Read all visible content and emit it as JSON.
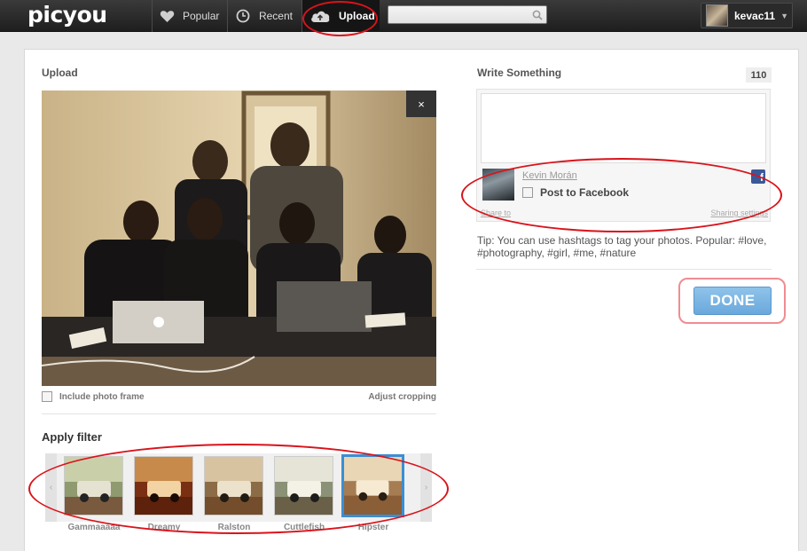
{
  "header": {
    "logo": "picyou",
    "nav": [
      {
        "label": "Popular",
        "icon": "heart-icon"
      },
      {
        "label": "Recent",
        "icon": "clock-icon"
      },
      {
        "label": "Upload",
        "icon": "cloud-upload-icon"
      }
    ],
    "search_placeholder": "",
    "username": "kevac11"
  },
  "upload": {
    "title": "Upload",
    "close_label": "×",
    "include_frame_label": "Include photo frame",
    "adjust_cropping_label": "Adjust cropping",
    "apply_filter_title": "Apply filter",
    "filters": [
      {
        "name": "Gammaaaaa",
        "selected": false
      },
      {
        "name": "Dreamy",
        "selected": false
      },
      {
        "name": "Ralston",
        "selected": false
      },
      {
        "name": "Cuttlefish",
        "selected": false
      },
      {
        "name": "Hipster",
        "selected": true
      }
    ]
  },
  "compose": {
    "title": "Write Something",
    "char_count": "110",
    "text": "",
    "fb_name": "Kevin Morán",
    "post_to_facebook_label": "Post to Facebook",
    "share_to_label": "Share to",
    "sharing_settings_label": "Sharing settings",
    "tip": "Tip: You can use hashtags to tag your photos. Popular: #love, #photography, #girl, #me, #nature",
    "done_label": "DONE"
  },
  "colors": {
    "accent": "#3b8ed4",
    "done_button": "#7bb5e2",
    "annotation": "#d9131b",
    "facebook": "#3b5998"
  }
}
